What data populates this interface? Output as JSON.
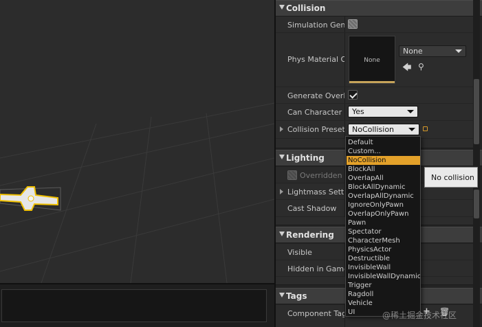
{
  "collision": {
    "title": "Collision",
    "simulation_label": "Simulation Gene",
    "phys_material_label": "Phys Material Ov",
    "phys_material_thumb": "None",
    "phys_material_value": "None",
    "generate_overlap_label": "Generate Overlap",
    "can_character_label": "Can Character St",
    "can_character_value": "Yes",
    "presets_label": "Collision Presets",
    "presets_value": "NoCollision"
  },
  "lighting": {
    "title": "Lighting",
    "overridden_label": "Overridden L",
    "lightmass_label": "Lightmass Settin",
    "cast_shadow_label": "Cast Shadow"
  },
  "rendering": {
    "title": "Rendering",
    "visible_label": "Visible",
    "hidden_in_game_label": "Hidden in Game"
  },
  "tags": {
    "title": "Tags",
    "component_tags_label": "Component Tags"
  },
  "dropdown": {
    "items": [
      "Default",
      "Custom...",
      "NoCollision",
      "BlockAll",
      "OverlapAll",
      "BlockAllDynamic",
      "OverlapAllDynamic",
      "IgnoreOnlyPawn",
      "OverlapOnlyPawn",
      "Pawn",
      "Spectator",
      "CharacterMesh",
      "PhysicsActor",
      "Destructible",
      "InvisibleWall",
      "InvisibleWallDynamic",
      "Trigger",
      "Ragdoll",
      "Vehicle",
      "UI"
    ],
    "selected": "NoCollision"
  },
  "tooltip": "No collision",
  "watermark": "@稀土掘金技术社区",
  "icons": {
    "collapse": "triangle-down",
    "expand": "triangle-right",
    "use_selected": "arrow-left-icon",
    "browse": "magnifier-icon",
    "add": "plus-icon",
    "delete": "trash-icon"
  },
  "colors": {
    "accent_selected": "#e3a12a",
    "panel_bg": "#242424",
    "viewport_bg": "#2c2c2c",
    "object_outline": "#f0c000"
  }
}
